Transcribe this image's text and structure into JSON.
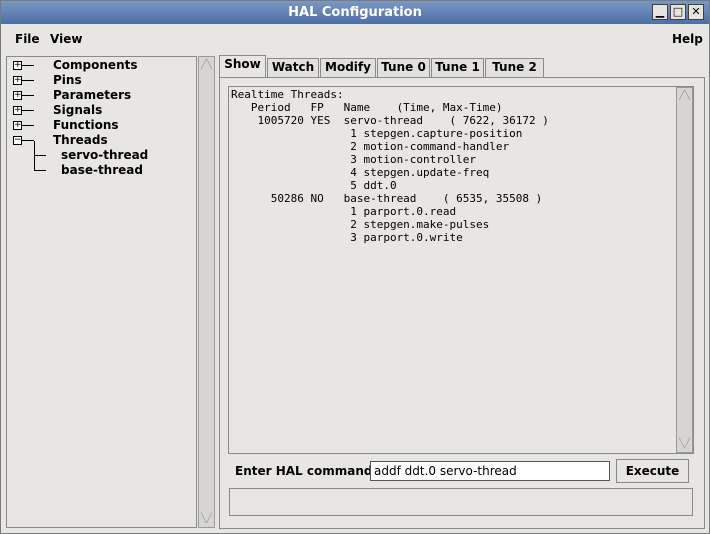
{
  "window": {
    "title": "HAL Configuration"
  },
  "menubar": {
    "file": "File",
    "view": "View",
    "help": "Help"
  },
  "tree": {
    "items": [
      {
        "label": "Components",
        "expander": "+"
      },
      {
        "label": "Pins",
        "expander": "+"
      },
      {
        "label": "Parameters",
        "expander": "+"
      },
      {
        "label": "Signals",
        "expander": "+"
      },
      {
        "label": "Functions",
        "expander": "+"
      },
      {
        "label": "Threads",
        "expander": "−"
      }
    ],
    "children": [
      {
        "label": "servo-thread"
      },
      {
        "label": "base-thread"
      }
    ]
  },
  "tabs": [
    {
      "label": "Show"
    },
    {
      "label": "Watch"
    },
    {
      "label": "Modify"
    },
    {
      "label": "Tune 0"
    },
    {
      "label": "Tune 1"
    },
    {
      "label": "Tune 2"
    }
  ],
  "output": {
    "text": "Realtime Threads:\n   Period   FP   Name    (Time, Max-Time)\n    1005720 YES  servo-thread    ( 7622, 36172 )\n                  1 stepgen.capture-position\n                  2 motion-command-handler\n                  3 motion-controller\n                  4 stepgen.update-freq\n                  5 ddt.0\n      50286 NO   base-thread    ( 6535, 35508 )\n                  1 parport.0.read\n                  2 stepgen.make-pulses\n                  3 parport.0.write"
  },
  "command": {
    "label": "Enter HAL command :",
    "value": "addf ddt.0 servo-thread",
    "execute_label": "Execute"
  }
}
